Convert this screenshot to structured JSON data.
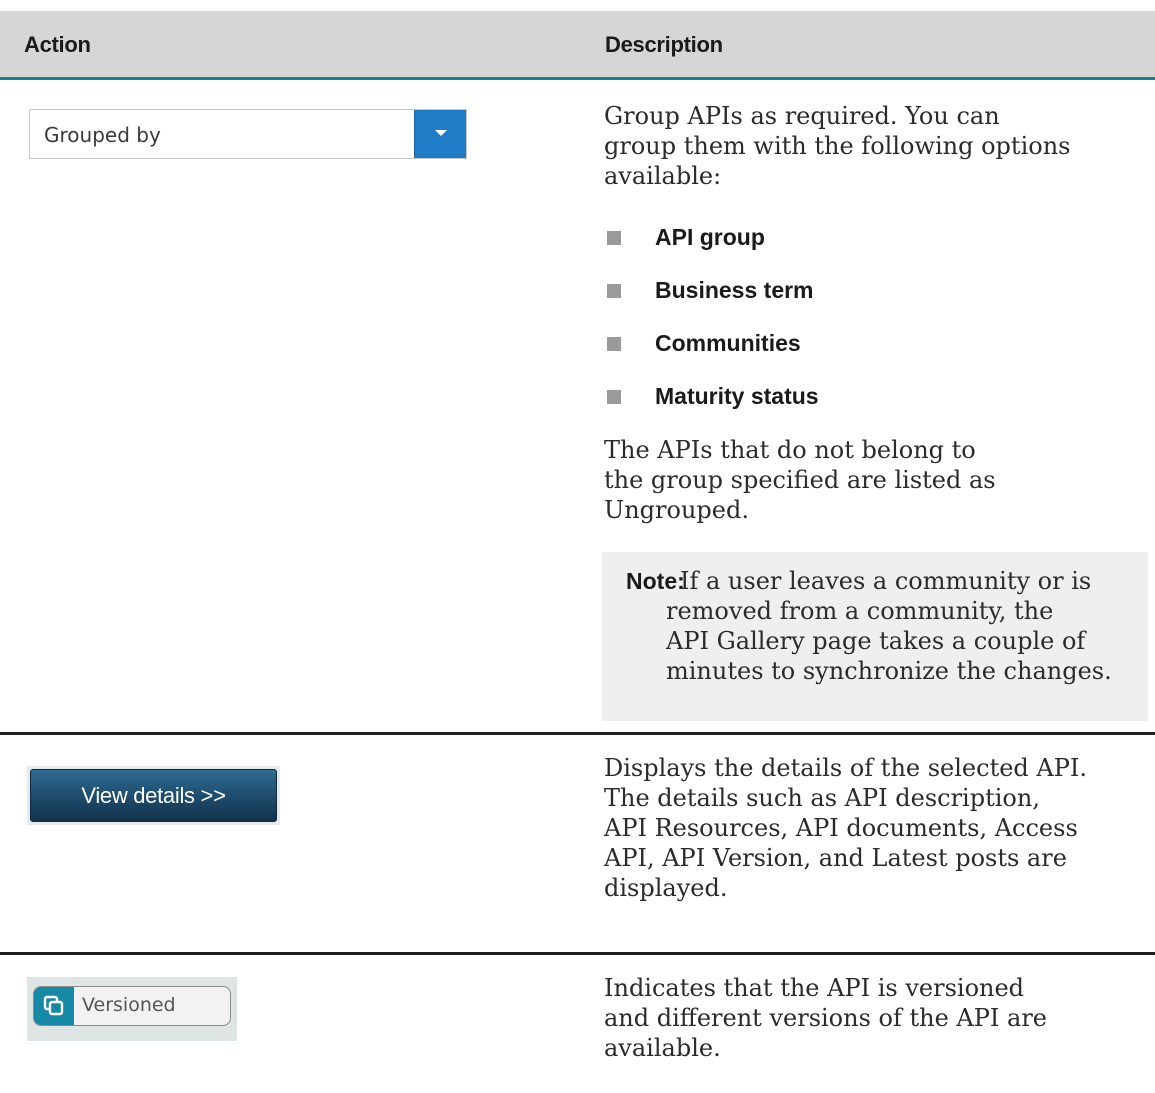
{
  "table": {
    "headers": {
      "action": "Action",
      "description": "Description"
    },
    "rows": [
      {
        "action": {
          "type": "dropdown",
          "label": "Grouped by",
          "icon": "caret-down-icon",
          "button_color": "#1f7cc6"
        },
        "description": {
          "lines_a": [
            "Group APIs as required. You can",
            "group them with the following options",
            "available:"
          ],
          "options": [
            "API group",
            "Business term",
            "Communities",
            "Maturity status"
          ],
          "lines_b": [
            "The APIs that do not belong to",
            "the group specified are listed as",
            "Ungrouped."
          ],
          "note": {
            "label": "Note:",
            "lines": [
              "If a user leaves a community or is",
              "removed from a community, the",
              "API Gallery page takes a couple of",
              "minutes to synchronize the changes."
            ]
          }
        }
      },
      {
        "action": {
          "type": "button",
          "label": "View details >>"
        },
        "description": {
          "lines": [
            "Displays the details of the selected API.",
            "The details such as API description,",
            "API Resources, API documents, Access",
            "API, API Version, and Latest posts are",
            "displayed."
          ]
        }
      },
      {
        "action": {
          "type": "badge",
          "label": "Versioned",
          "icon": "copy-icon",
          "icon_color": "#1589a6"
        },
        "description": {
          "lines": [
            "Indicates that the API is versioned",
            "and different versions of the API are",
            "available."
          ]
        }
      }
    ]
  },
  "colors": {
    "header_bg": "#d6d6d6",
    "header_rule": "#1b7d8e",
    "note_bg": "#efefef",
    "bullet": "#9a9a9a"
  }
}
